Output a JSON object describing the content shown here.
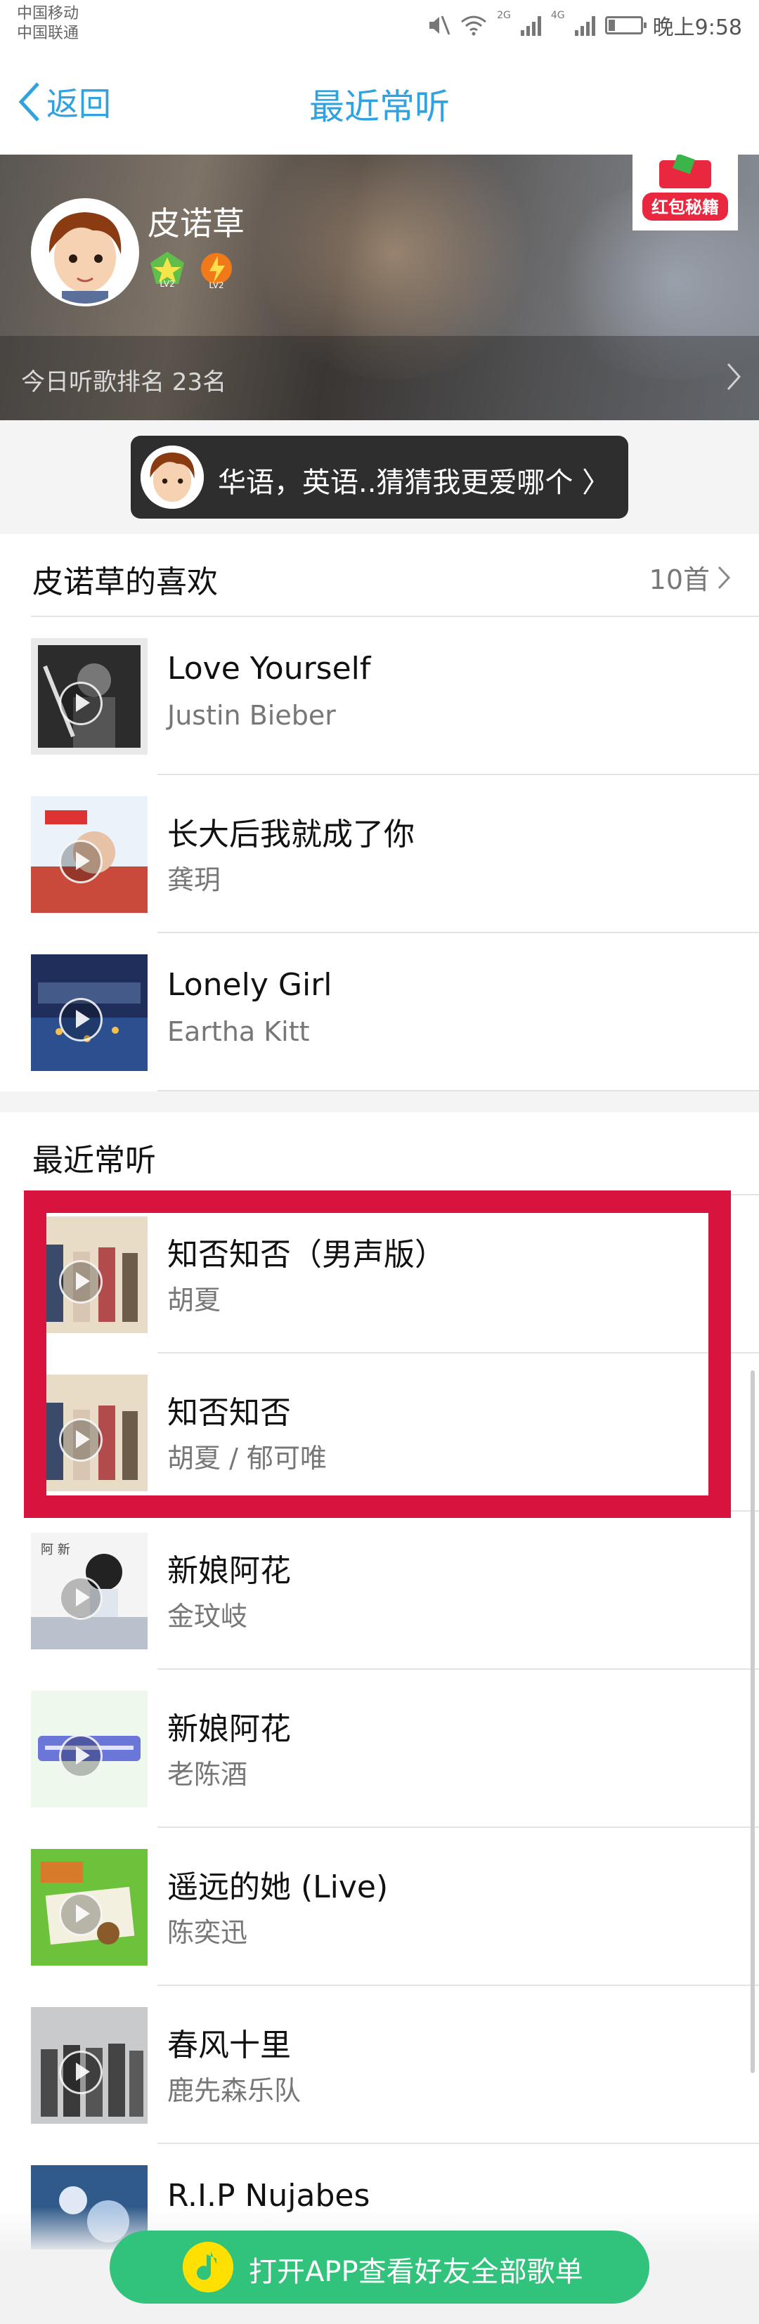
{
  "status_bar": {
    "carrier_1": "中国移动",
    "carrier_2": "中国联通",
    "network_1": "2G",
    "network_2": "4G",
    "time": "晚上9:58"
  },
  "header": {
    "back_label": "返回",
    "title": "最近常听"
  },
  "profile": {
    "username": "皮诺草",
    "level_1": "LV2",
    "level_2": "LV2",
    "rank_text": "今日听歌排名 23名",
    "promo_badge": "红包秘籍"
  },
  "prompt": {
    "text": "华语，英语..猜猜我更爱哪个"
  },
  "favorites": {
    "title": "皮诺草的喜欢",
    "count": "10首",
    "songs": [
      {
        "name": "Love Yourself",
        "artist": "Justin Bieber"
      },
      {
        "name": "长大后我就成了你",
        "artist": "龚玥"
      },
      {
        "name": "Lonely Girl",
        "artist": "Eartha Kitt"
      }
    ]
  },
  "recent": {
    "title": "最近常听",
    "songs": [
      {
        "name": "知否知否（男声版）",
        "artist": "胡夏"
      },
      {
        "name": "知否知否",
        "artist": "胡夏 / 郁可唯"
      },
      {
        "name": "新娘阿花",
        "artist": "金玟岐"
      },
      {
        "name": "新娘阿花",
        "artist": "老陈酒"
      },
      {
        "name": "遥远的她 (Live)",
        "artist": "陈奕迅"
      },
      {
        "name": "春风十里",
        "artist": "鹿先森乐队"
      },
      {
        "name": "R.I.P Nujabes",
        "artist": ""
      }
    ]
  },
  "cta": {
    "label": "打开APP查看好友全部歌单"
  },
  "colors": {
    "accent": "#31a2e0",
    "highlight": "#d8133e",
    "cta": "#31c27c"
  }
}
